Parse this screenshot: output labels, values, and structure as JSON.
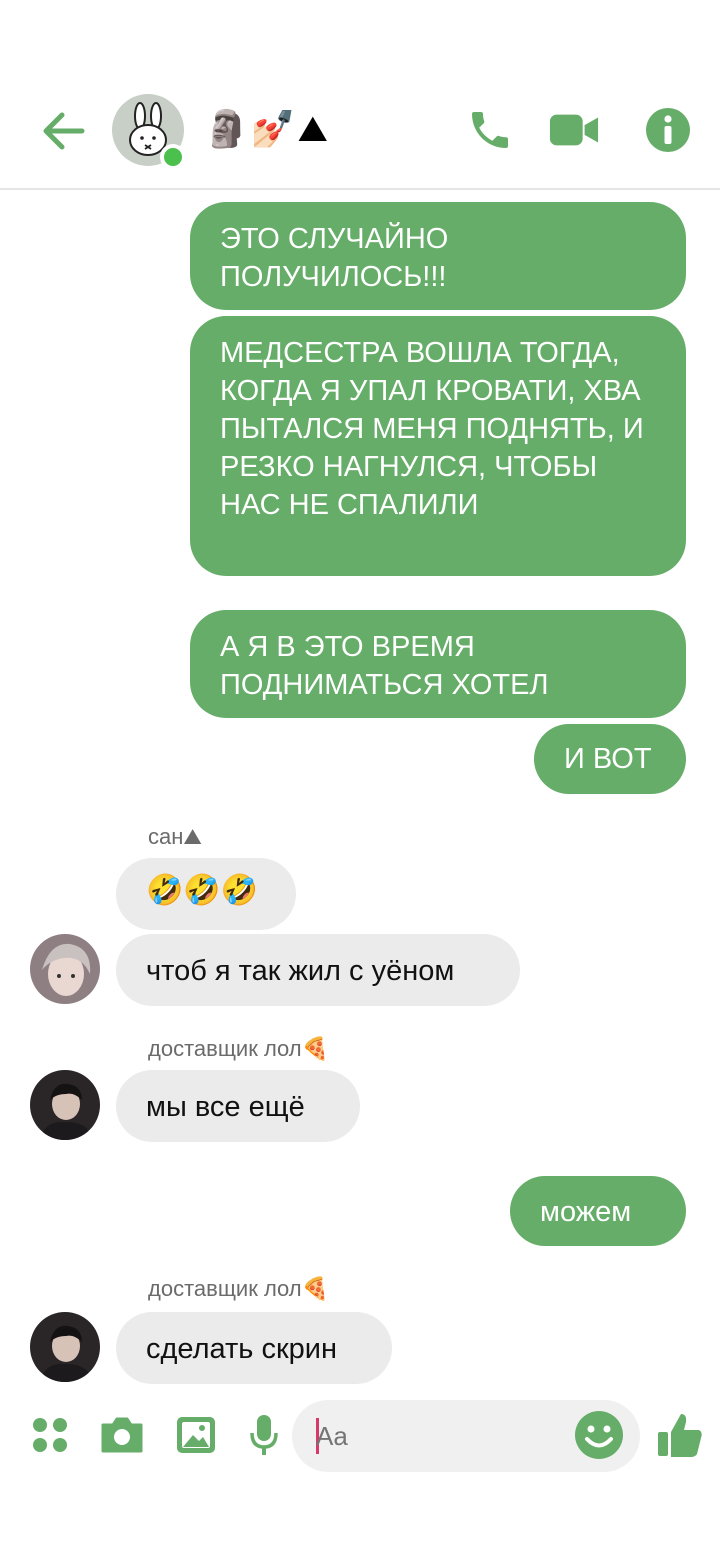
{
  "header": {
    "title": "🗿💅🏻⛰",
    "accent": "#66ad69"
  },
  "messages": [
    {
      "id": "m1",
      "side": "out",
      "text": "ЭТО СЛУЧАЙНО ПОЛУЧИЛОСЬ!!!"
    },
    {
      "id": "m2",
      "side": "out",
      "text": "МЕДСЕСТРА ВОШЛА ТОГДА, КОГДА Я УПАЛ КРОВАТИ, ХВА ПЫТАЛСЯ МЕНЯ ПОДНЯТЬ, И РЕЗКО НАГНУЛСЯ, ЧТОБЫ НАС НЕ СПАЛИЛИ"
    },
    {
      "id": "m3",
      "side": "out",
      "text": "А Я В ЭТО ВРЕМЯ ПОДНИМАТЬСЯ ХОТЕЛ"
    },
    {
      "id": "m4",
      "side": "out",
      "text": "И ВОТ"
    },
    {
      "id": "m5",
      "side": "in",
      "sender": "сан⛰",
      "text": "🤣🤣🤣"
    },
    {
      "id": "m6",
      "side": "in",
      "text": "чтоб я так жил с уёном"
    },
    {
      "id": "m7",
      "side": "in",
      "sender": "доставщик лол🍕",
      "text": "мы все ещё"
    },
    {
      "id": "m8",
      "side": "out",
      "text": "можем"
    },
    {
      "id": "m9",
      "side": "in",
      "sender": "доставщик лол🍕",
      "text": "сделать скрин"
    }
  ],
  "composer": {
    "placeholder": "Aa"
  },
  "icons": {
    "back": "arrow-left-icon",
    "call": "phone-icon",
    "video": "video-camera-icon",
    "info": "info-icon",
    "apps": "four-dots-icon",
    "camera": "camera-icon",
    "gallery": "image-icon",
    "mic": "microphone-icon",
    "emoji": "smiley-icon",
    "like": "thumbs-up-icon"
  }
}
